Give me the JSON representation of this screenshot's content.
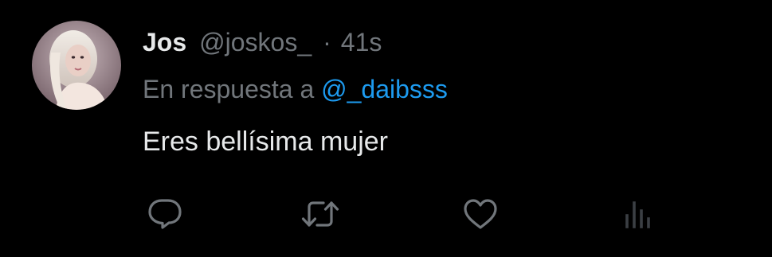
{
  "tweet": {
    "display_name": "Jos",
    "handle": "@joskos_",
    "separator": "·",
    "timestamp": "41s",
    "reply_prefix": "En respuesta a",
    "reply_mention": "@_daibsss",
    "text": "Eres bellísima mujer"
  },
  "actions": {
    "reply_icon": "reply-icon",
    "retweet_icon": "retweet-icon",
    "like_icon": "heart-icon",
    "views_icon": "analytics-icon"
  },
  "colors": {
    "background": "#000000",
    "primary_text": "#e7e9ea",
    "secondary_text": "#71767b",
    "link": "#1d9bf0"
  }
}
